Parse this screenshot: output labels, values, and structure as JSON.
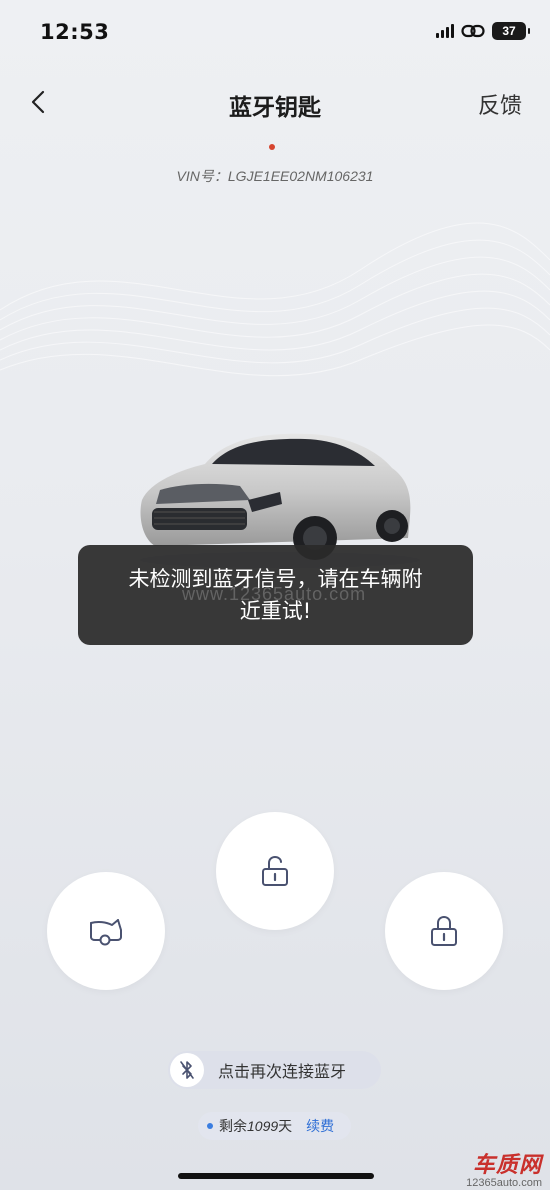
{
  "status_bar": {
    "time": "12:53",
    "battery": "37"
  },
  "nav": {
    "title": "蓝牙钥匙",
    "feedback": "反馈"
  },
  "vehicle": {
    "vin_label": "VIN号：",
    "vin": "LGJE1EE02NM106231"
  },
  "toast": {
    "line1": "未检测到蓝牙信号，请在车辆附",
    "line2": "近重试!"
  },
  "watermark": "www.12365auto.com",
  "controls": {
    "unlock_icon": "unlock-icon",
    "trunk_icon": "trunk-icon",
    "lock_icon": "lock-icon"
  },
  "bluetooth": {
    "reconnect_label": "点击再次连接蓝牙",
    "icon": "bluetooth-off-icon"
  },
  "subscription": {
    "remaining_prefix": "剩余",
    "days": "1099",
    "unit": "天",
    "renew_label": "续费"
  },
  "logo": {
    "name": "车质网",
    "url": "12365auto.com"
  },
  "colors": {
    "accent_blue": "#2f6fd6",
    "red_dot": "#d6452f",
    "toast_bg": "#2a2a2a",
    "logo_red": "#c9302c"
  }
}
